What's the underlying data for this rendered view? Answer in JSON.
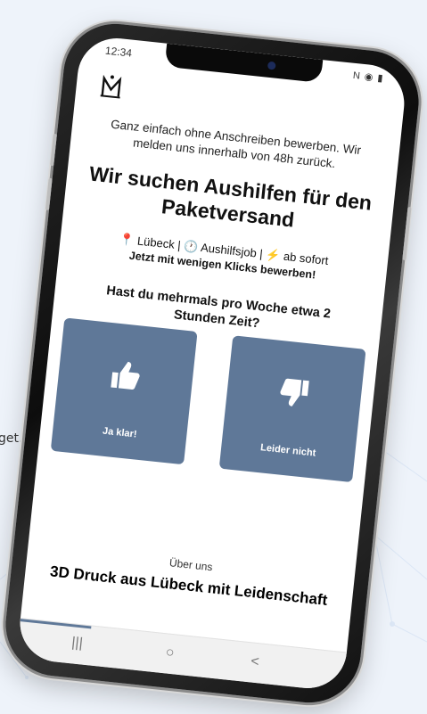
{
  "status": {
    "time": "12:34",
    "icons": "N ◉ ▮"
  },
  "hero": {
    "intro": "Ganz einfach ohne Anschreiben bewerben. Wir melden uns innerhalb von 48h zurück.",
    "headline": "Wir suchen Aushilfen für den Paketversand",
    "meta": "📍 Lübeck | 🕐 Aushilfsjob | ⚡ ab sofort",
    "cta": "Jetzt mit wenigen Klicks bewerben!"
  },
  "question": "Hast du mehrmals pro Woche etwa 2 Stunden Zeit?",
  "options": [
    {
      "label": "Ja klar!",
      "icon": "thumbs-up-icon"
    },
    {
      "label": "Leider nicht",
      "icon": "thumbs-down-icon"
    }
  ],
  "about": {
    "small": "Über uns",
    "title": "3D Druck aus Lübeck mit Leidenschaft"
  },
  "nav": {
    "recents": "|||",
    "home": "○",
    "back": "<"
  },
  "side_text": "get.",
  "colors": {
    "option_bg": "#5f7898",
    "page_bg": "#eef3fa"
  }
}
